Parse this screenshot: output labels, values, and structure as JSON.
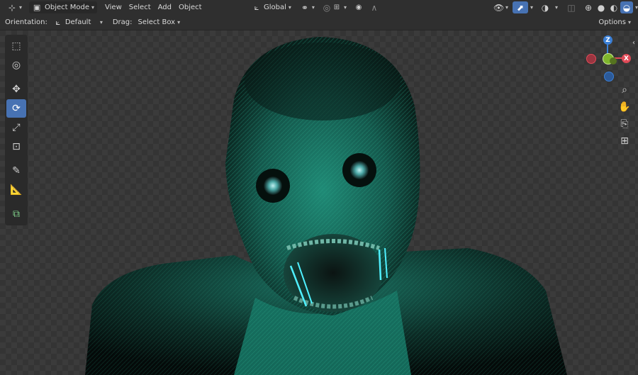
{
  "header": {
    "editor_icon": "editor-type-3d-viewport-icon",
    "mode_label": "Object Mode",
    "menus": [
      "View",
      "Select",
      "Add",
      "Object"
    ],
    "transform_orientation": "Global"
  },
  "tool_settings": {
    "orientation_label": "Orientation:",
    "orientation_value": "Default",
    "drag_label": "Drag:",
    "drag_value": "Select Box",
    "options_label": "Options"
  },
  "toolbar": {
    "tools": [
      {
        "name": "select-box-icon",
        "active": false
      },
      {
        "name": "cursor-icon",
        "active": false
      },
      {
        "name": "move-icon",
        "active": false
      },
      {
        "name": "rotate-icon",
        "active": true
      },
      {
        "name": "scale-icon",
        "active": false
      },
      {
        "name": "transform-icon",
        "active": false
      },
      {
        "name": "annotate-icon",
        "active": false
      },
      {
        "name": "measure-icon",
        "active": false
      },
      {
        "name": "add-cube-icon",
        "active": false
      }
    ]
  },
  "gizmo": {
    "z_label": "Z",
    "x_label": "X",
    "colors": {
      "x": "#e04a57",
      "y": "#7fb52d",
      "z": "#3a7fd6"
    }
  },
  "colors": {
    "accent": "#4772b3",
    "model_tint": "#1e8a74",
    "glow": "#4ff0ff"
  }
}
